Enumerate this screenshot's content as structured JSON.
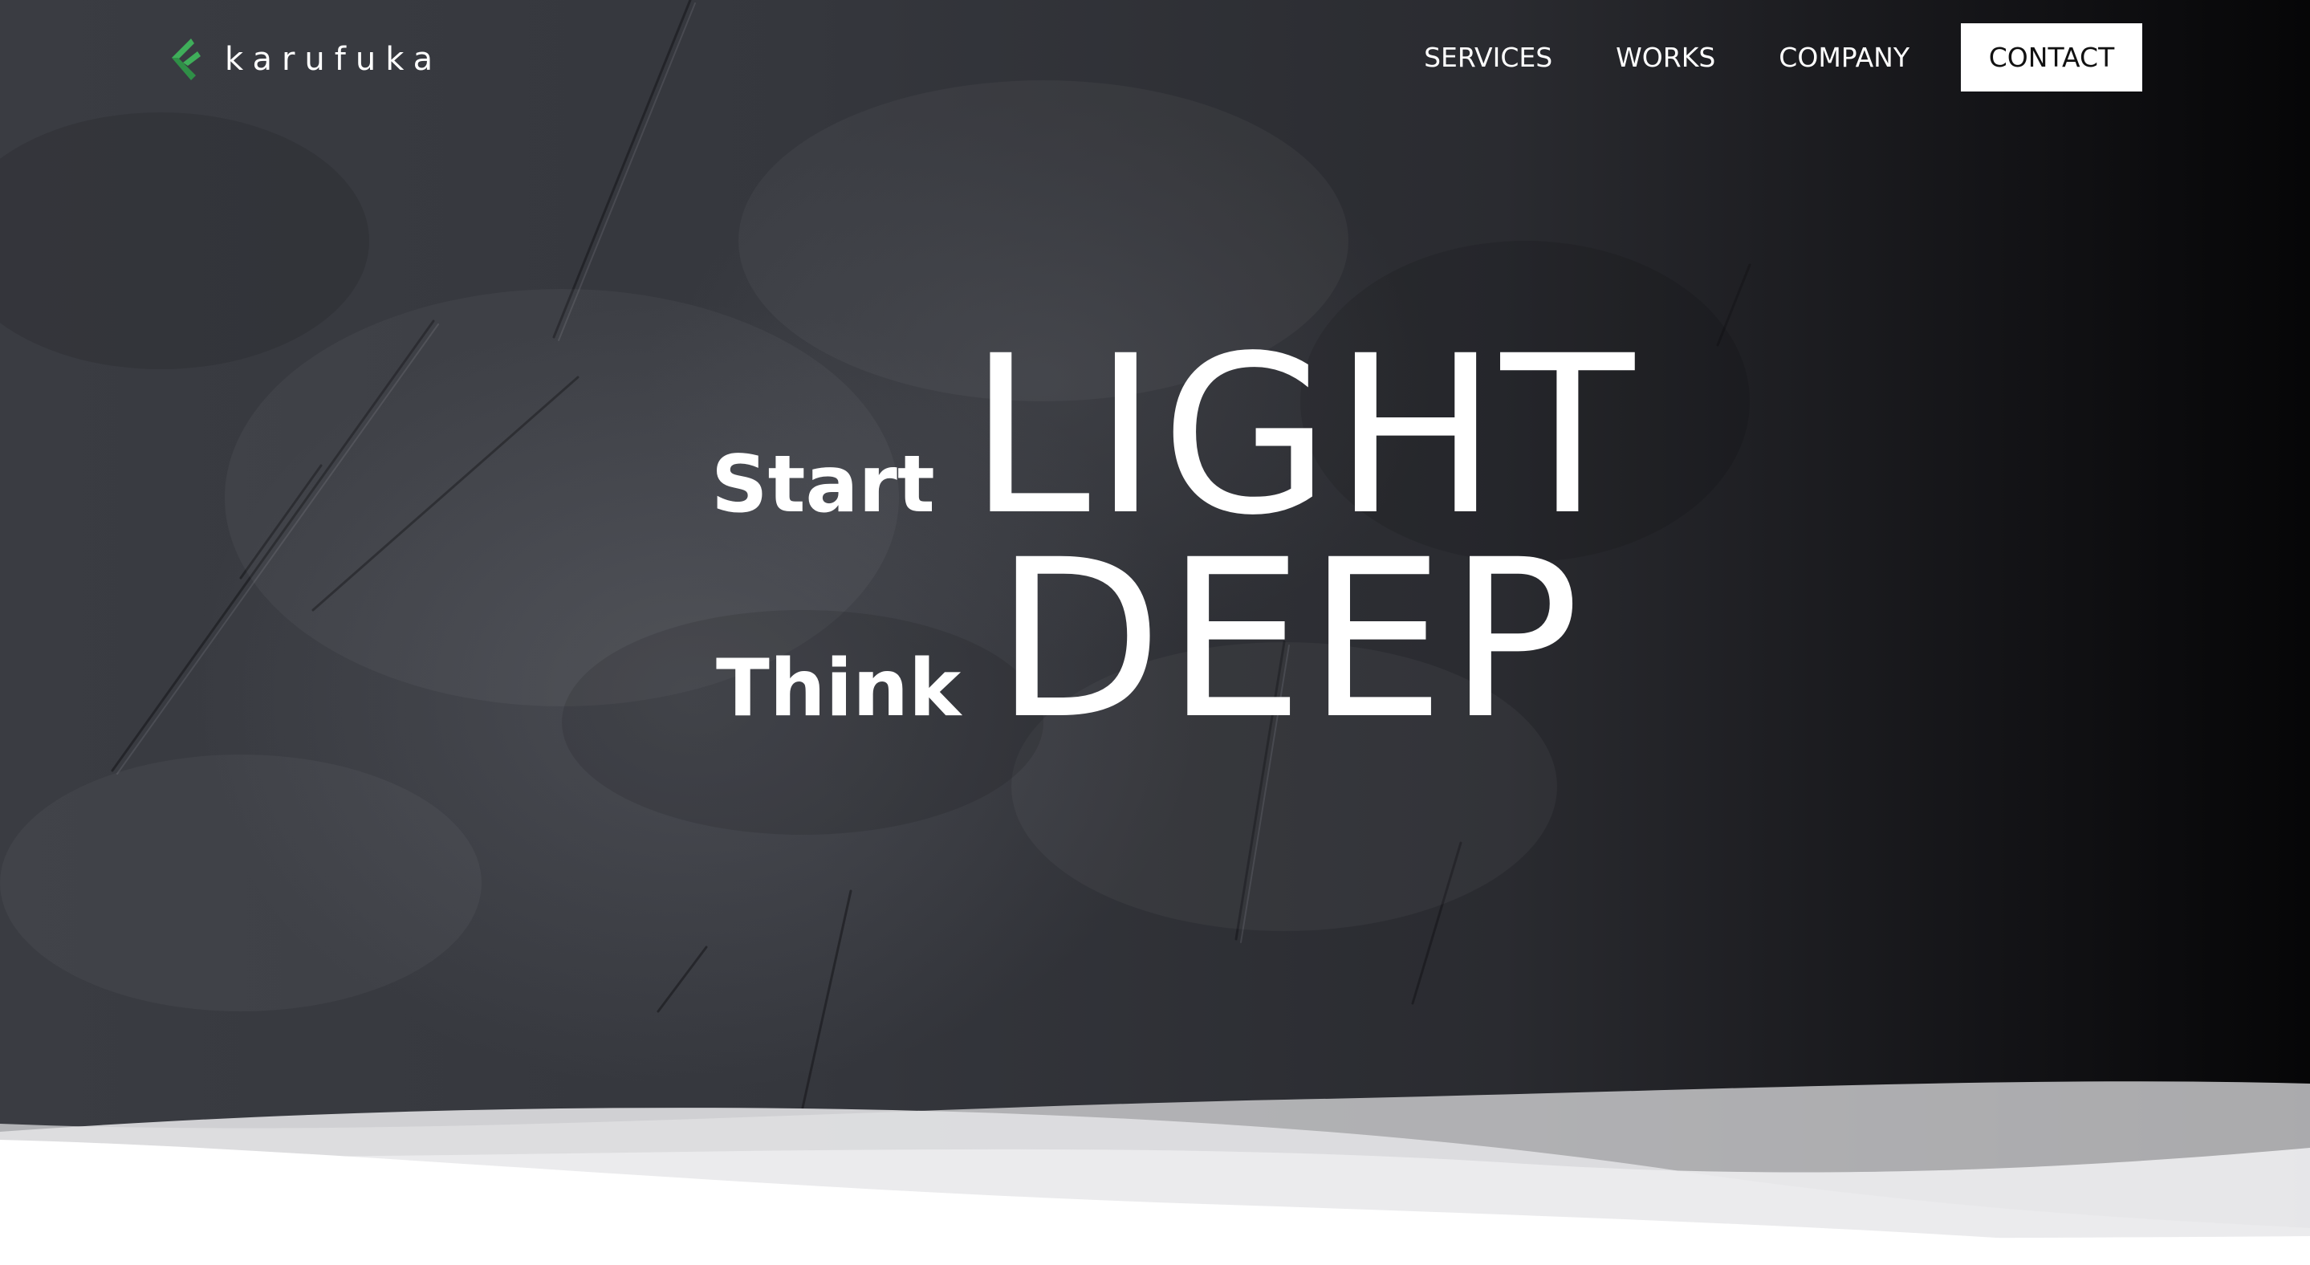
{
  "brand": {
    "name": "karufuka",
    "logo_icon": "karufuka-leaf-logo-icon",
    "accent_color": "#3fae5a"
  },
  "nav": {
    "items": [
      {
        "label": "SERVICES"
      },
      {
        "label": "WORKS"
      },
      {
        "label": "COMPANY"
      }
    ],
    "contact_label": "CONTACT"
  },
  "hero": {
    "line1_small": "Start",
    "line1_big": "LIGHT",
    "line2_small": "Think",
    "line2_big": "DEEP",
    "text_color": "#ffffff",
    "background": "dark textured concrete"
  }
}
